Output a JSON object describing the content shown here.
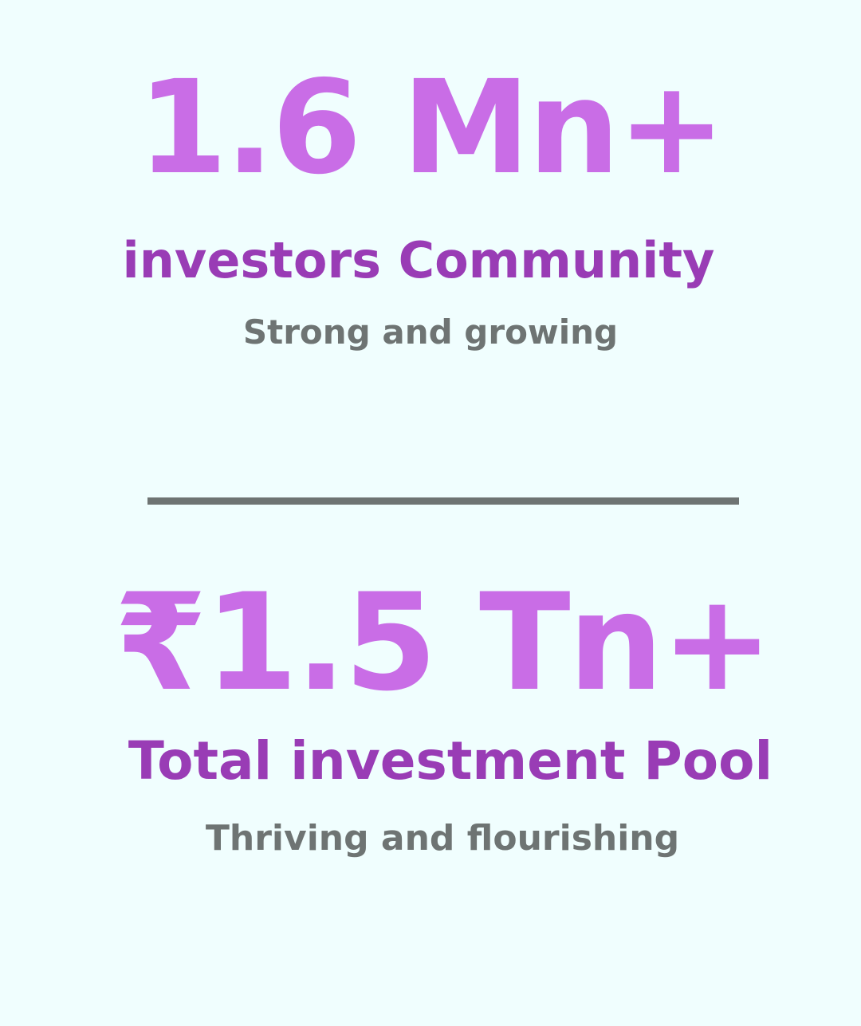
{
  "stats": [
    {
      "value": "1.6 Mn+",
      "label": "investors Community",
      "subtitle": "Strong and growing"
    },
    {
      "value": "₹1.5 Tn+",
      "label": "Total investment Pool",
      "subtitle": "Thriving and flourishing"
    }
  ],
  "colors": {
    "background": "#f0fefe",
    "value": "#c96de6",
    "label": "#993cb5",
    "subtitle": "#6e7473",
    "divider": "#6e7473"
  }
}
